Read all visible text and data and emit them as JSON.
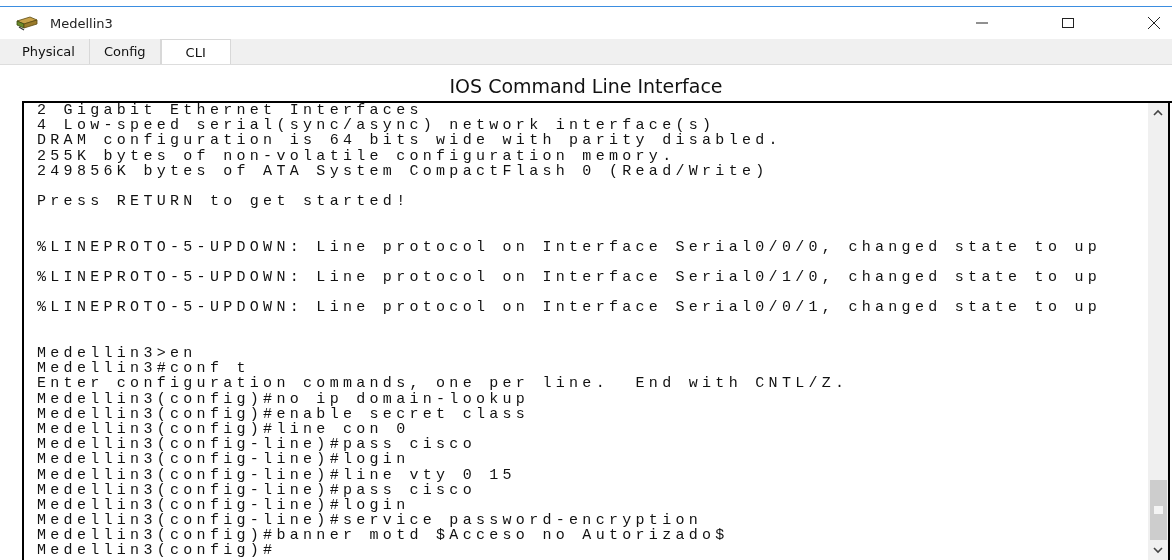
{
  "window": {
    "title": "Medellin3"
  },
  "tabs": [
    {
      "label": "Physical",
      "selected": false
    },
    {
      "label": "Config",
      "selected": false
    },
    {
      "label": "CLI",
      "selected": true
    }
  ],
  "heading": "IOS Command Line Interface",
  "terminal": {
    "lines": [
      {
        "text": "2 Gigabit Ethernet Interfaces",
        "kind": "line"
      },
      {
        "text": "4 Low-speed serial(sync/async) network interface(s)",
        "kind": "line"
      },
      {
        "text": "DRAM configuration is 64 bits wide with parity disabled.",
        "kind": "line"
      },
      {
        "text": "255K bytes of non-volatile configuration memory.",
        "kind": "line"
      },
      {
        "text": "249856K bytes of ATA System CompactFlash 0 (Read/Write)",
        "kind": "line"
      },
      {
        "text": "Press RETURN to get started!",
        "kind": "after_blank"
      },
      {
        "text": "%LINEPROTO-5-UPDOWN: Line protocol on Interface Serial0/0/0, changed state to up",
        "kind": "after_two_blanks"
      },
      {
        "text": "%LINEPROTO-5-UPDOWN: Line protocol on Interface Serial0/1/0, changed state to up",
        "kind": "after_blank"
      },
      {
        "text": "%LINEPROTO-5-UPDOWN: Line protocol on Interface Serial0/0/1, changed state to up",
        "kind": "after_blank"
      },
      {
        "text": "Medellin3>en",
        "kind": "after_two_blanks"
      },
      {
        "text": "Medellin3#conf t",
        "kind": "line"
      },
      {
        "text": "Enter configuration commands, one per line.  End with CNTL/Z.",
        "kind": "line"
      },
      {
        "text": "Medellin3(config)#no ip domain-lookup",
        "kind": "line"
      },
      {
        "text": "Medellin3(config)#enable secret class",
        "kind": "line"
      },
      {
        "text": "Medellin3(config)#line con 0",
        "kind": "line"
      },
      {
        "text": "Medellin3(config-line)#pass cisco",
        "kind": "line"
      },
      {
        "text": "Medellin3(config-line)#login",
        "kind": "line"
      },
      {
        "text": "Medellin3(config-line)#line vty 0 15",
        "kind": "line"
      },
      {
        "text": "Medellin3(config-line)#pass cisco",
        "kind": "line"
      },
      {
        "text": "Medellin3(config-line)#login",
        "kind": "line"
      },
      {
        "text": "Medellin3(config-line)#service password-encryption",
        "kind": "line"
      },
      {
        "text": "Medellin3(config)#banner motd $Acceso no Autorizado$",
        "kind": "line"
      },
      {
        "text": "Medellin3(config)#",
        "kind": "line"
      }
    ]
  }
}
